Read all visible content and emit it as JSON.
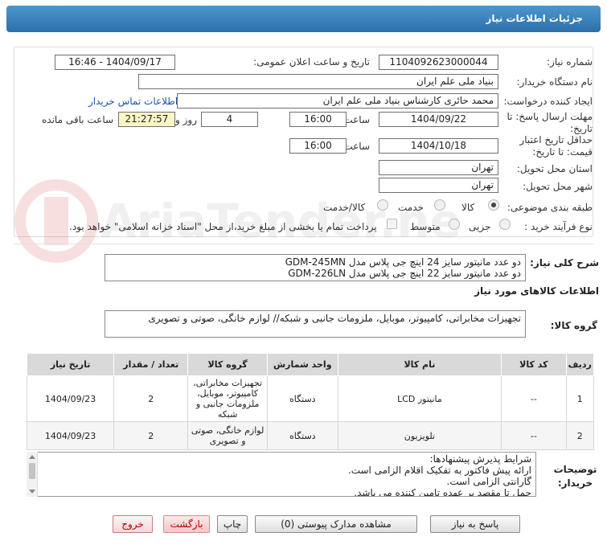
{
  "header": {
    "title": "جزئیات اطلاعات نیاز"
  },
  "form": {
    "need_number_label": "شماره نیاز:",
    "need_number": "1104092623000044",
    "announce_label": "تاریخ و ساعت اعلان عمومی:",
    "announce_value": "1404/09/17 - 16:46",
    "buyer_label": "نام دستگاه خریدار:",
    "buyer_value": "بنیاد ملی علم ایران",
    "creator_label": "ایجاد کننده درخواست:",
    "creator_value": "محمد حائری کارشناس بنیاد ملی علم ایران",
    "contact_link": "اطلاعات تماس خریدار",
    "deadline_label": "مهلت ارسال پاسخ: تا تاریخ:",
    "deadline_date": "1404/09/22",
    "time_label": "ساعت",
    "deadline_time": "16:00",
    "days_value": "4",
    "days_label": "روز و",
    "remaining_value": "21:27:57",
    "remaining_label": "ساعت باقی مانده",
    "validity_label": "حداقل تاریخ اعتبار قیمت: تا تاریخ:",
    "validity_date": "1404/10/18",
    "validity_time": "16:00",
    "province_label": "استان محل تحویل:",
    "province_value": "تهران",
    "city_label": "شهر محل تحویل:",
    "city_value": "تهران",
    "category_label": "طبقه بندی موضوعی:",
    "category_options": [
      "کالا",
      "خدمت",
      "کالا/خدمت"
    ],
    "category_selected": "کالا",
    "purchase_label": "نوع فرآیند خرید :",
    "purchase_options": [
      "جزیی",
      "متوسط"
    ],
    "payment_note": "پرداخت تمام یا بخشی از مبلغ خرید،از محل \"اسناد خزانه اسلامی\" خواهد بود."
  },
  "summary": {
    "label": "شرح کلی نیاز:",
    "lines": [
      "دو عدد مانیتور سایز 24 اینچ جی پلاس مدل GDM-245MN",
      "دو عدد مانیتور سایز 22 اینچ جی پلاس مدل GDM-226LN"
    ]
  },
  "goods": {
    "section_title": "اطلاعات کالاهای مورد نیاز",
    "group_label": "گروه کالا:",
    "group_value": "تجهیزات مخابراتی، کامپیوتر، موبایل، ملزومات جانبی و شبکه// لوازم خانگی، صوتی و تصویری"
  },
  "table": {
    "headers": [
      "ردیف",
      "کد کالا",
      "نام کالا",
      "واحد شمارش",
      "گروه کالا",
      "تعداد / مقدار",
      "تاریخ نیاز"
    ],
    "rows": [
      [
        "1",
        "--",
        "مانیتور LCD",
        "دستگاه",
        "تجهیزات مخابراتی، کامپیوتر، موبایل، ملزومات جانبی و شبکه",
        "2",
        "1404/09/23"
      ],
      [
        "2",
        "--",
        "تلویزیون",
        "دستگاه",
        "لوازم خانگی، صوتی و تصویری",
        "2",
        "1404/09/23"
      ]
    ]
  },
  "notes": {
    "label": "توضیحات خریدار:",
    "lines": [
      "شرایط پذیرش پیشنهادها:",
      "ارائه پیش فاکتور به تفکیک اقلام الزامی است.",
      "گارانتی الزامی است.",
      "حمل تا مقصد بر عهده تامین کننده می باشد."
    ]
  },
  "buttons": {
    "reply": "پاسخ به نیاز",
    "attachments": "مشاهده مدارک پیوستی (0)",
    "print": "چاپ",
    "back": "بازگشت",
    "exit": "خروج"
  },
  "watermark": {
    "text": "AriaTender.net"
  }
}
